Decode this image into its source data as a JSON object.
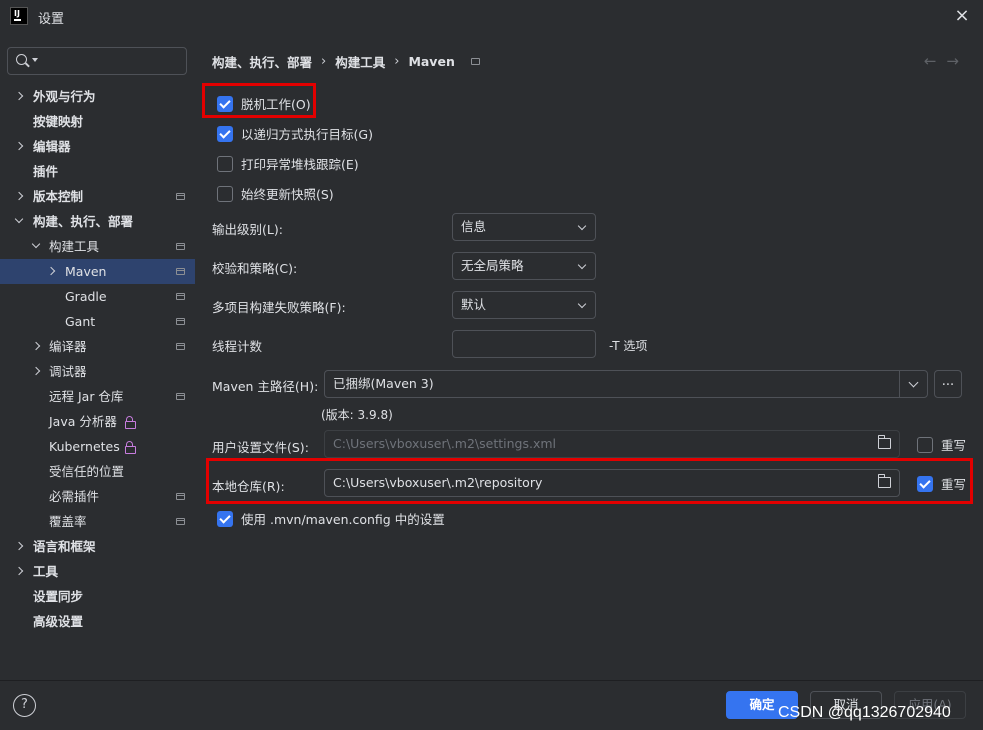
{
  "window": {
    "title": "设置",
    "close_icon": "×"
  },
  "search": {
    "placeholder": ""
  },
  "sidebar": {
    "items": [
      {
        "label": "外观与行为"
      },
      {
        "label": "按键映射"
      },
      {
        "label": "编辑器"
      },
      {
        "label": "插件"
      },
      {
        "label": "版本控制"
      },
      {
        "label": "构建、执行、部署"
      },
      {
        "label": "构建工具"
      },
      {
        "label": "Maven"
      },
      {
        "label": "Gradle"
      },
      {
        "label": "Gant"
      },
      {
        "label": "编译器"
      },
      {
        "label": "调试器"
      },
      {
        "label": "远程 Jar 仓库"
      },
      {
        "label": "Java 分析器"
      },
      {
        "label": "Kubernetes"
      },
      {
        "label": "受信任的位置"
      },
      {
        "label": "必需插件"
      },
      {
        "label": "覆盖率"
      },
      {
        "label": "语言和框架"
      },
      {
        "label": "工具"
      },
      {
        "label": "设置同步"
      },
      {
        "label": "高级设置"
      }
    ]
  },
  "breadcrumb": {
    "part1": "构建、执行、部署",
    "part2": "构建工具",
    "part3": "Maven",
    "sep": "›"
  },
  "nav": {
    "back_forward": "←→"
  },
  "options": {
    "offline": {
      "label": "脱机工作(O)",
      "checked": true
    },
    "recursive": {
      "label": "以递归方式执行目标(G)",
      "checked": true
    },
    "print_stack": {
      "label": "打印异常堆栈跟踪(E)",
      "checked": false
    },
    "always_update": {
      "label": "始终更新快照(S)",
      "checked": false
    }
  },
  "fields": {
    "output_level": {
      "label": "输出级别(L):",
      "value": "信息"
    },
    "checksum": {
      "label": "校验和策略(C):",
      "value": "无全局策略"
    },
    "fail_policy": {
      "label": "多项目构建失败策略(F):",
      "value": "默认"
    },
    "threads": {
      "label": "线程计数",
      "value": "",
      "hint": "-T 选项"
    },
    "maven_home": {
      "label": "Maven 主路径(H):",
      "value": "已捆绑(Maven 3)",
      "version": "(版本: 3.9.8)",
      "more": "..."
    },
    "user_settings": {
      "label": "用户设置文件(S):",
      "value": "C:\\Users\\vboxuser\\.m2\\settings.xml",
      "override_label": "重写",
      "override": false
    },
    "local_repo": {
      "label": "本地仓库(R):",
      "value": "C:\\Users\\vboxuser\\.m2\\repository",
      "override_label": "重写",
      "override": true
    },
    "mvn_config": {
      "label": "使用 .mvn/maven.config 中的设置",
      "checked": true
    }
  },
  "footer": {
    "help": "?",
    "ok": "确定",
    "cancel": "取消",
    "apply": "应用(A)",
    "watermark": "CSDN @qq1326702940"
  },
  "colors": {
    "accent": "#3574f0",
    "highlight": "#e30000",
    "selection": "#2e436e",
    "background": "#2b2d30"
  }
}
